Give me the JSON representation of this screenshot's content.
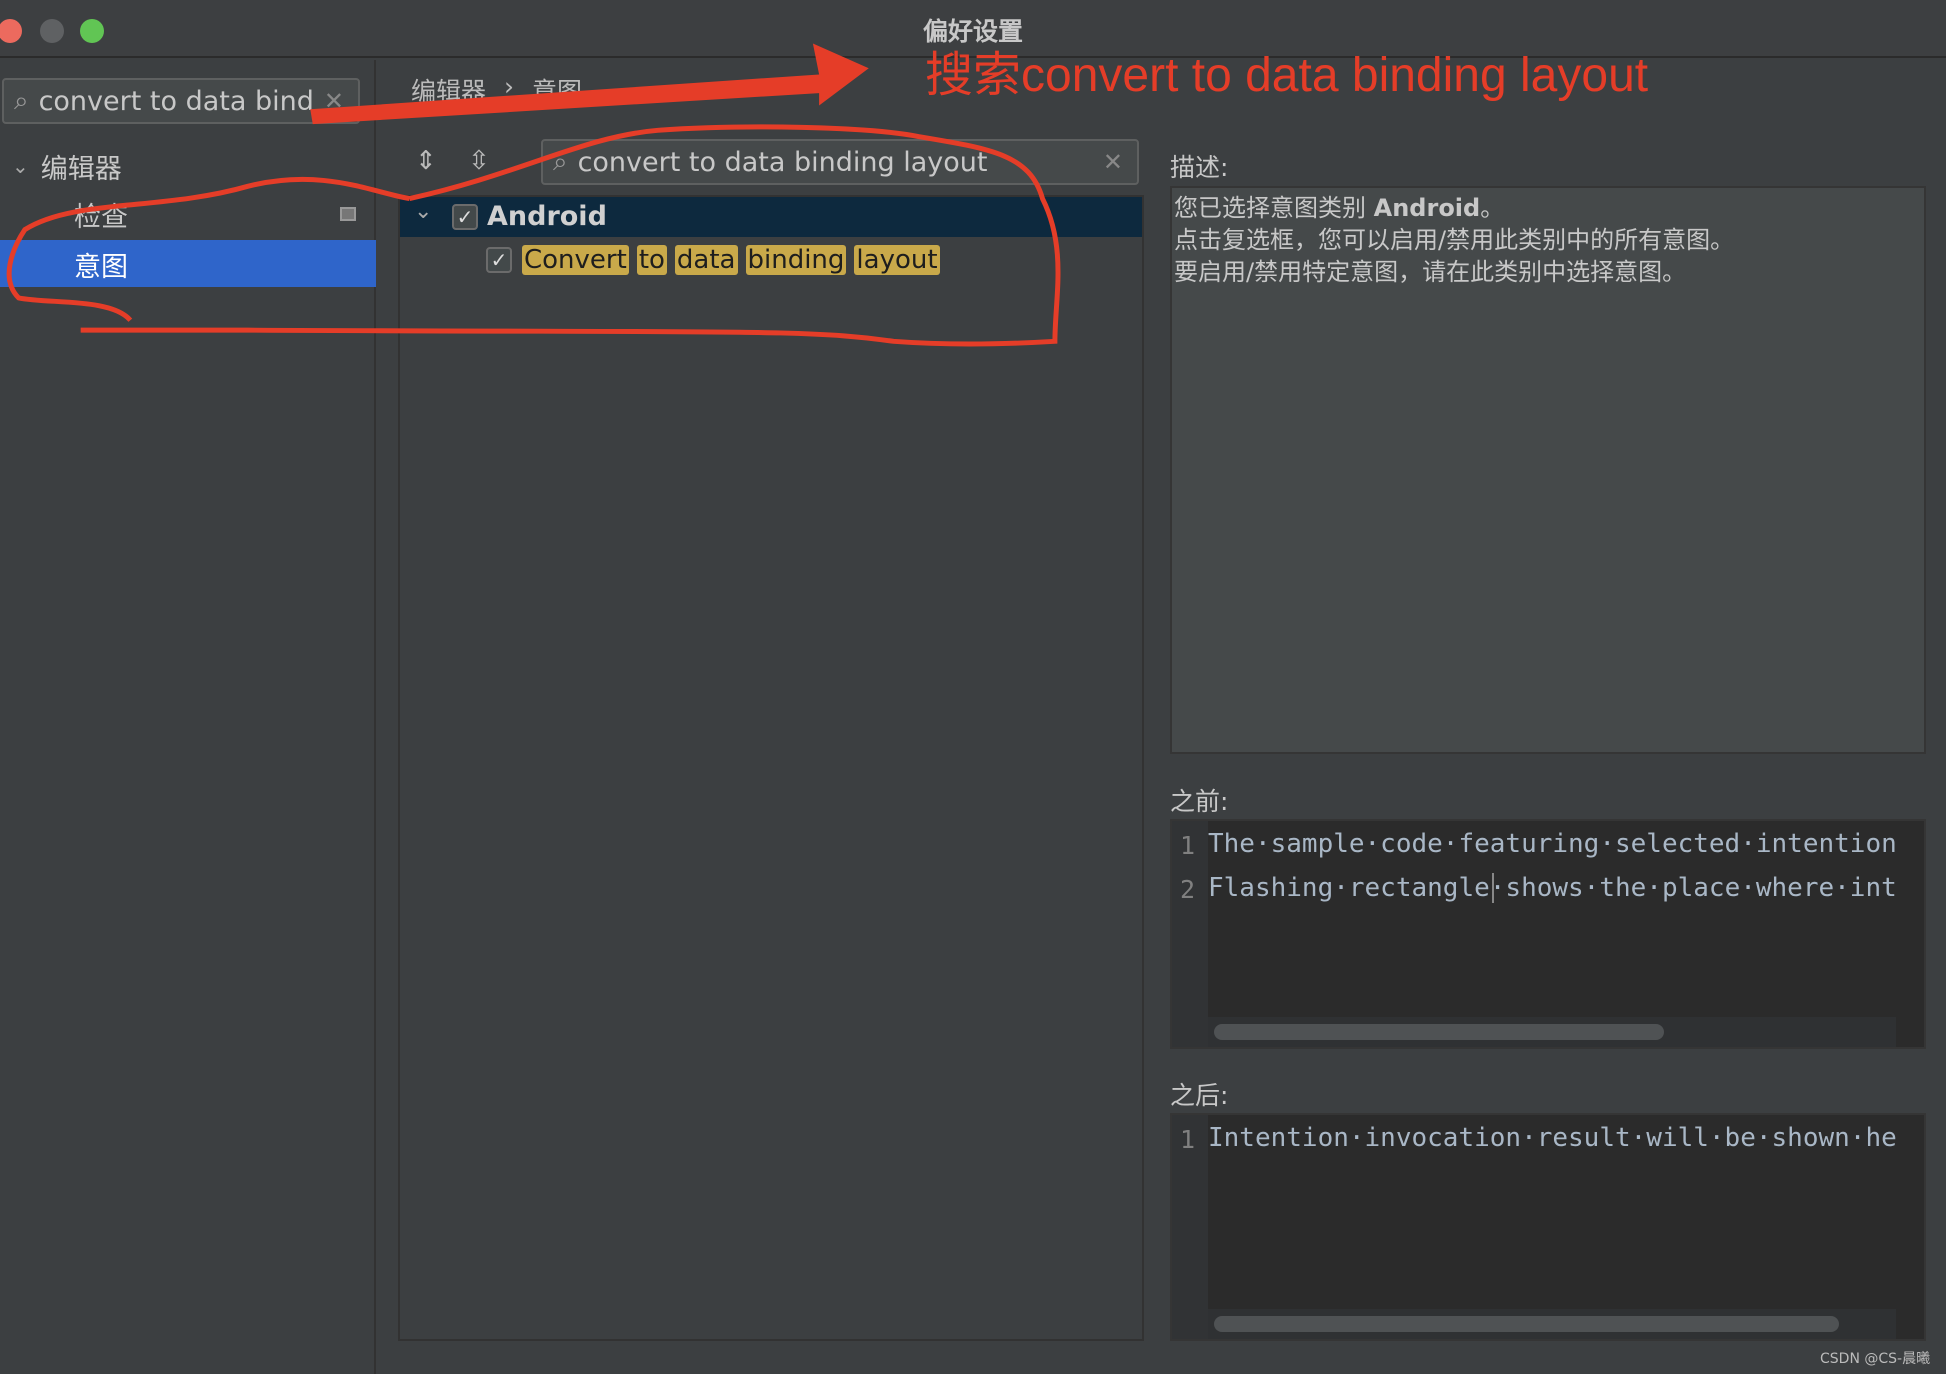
{
  "window": {
    "title": "偏好设置"
  },
  "sidebar": {
    "search_value": "convert to data bind",
    "tree": [
      {
        "label": "编辑器",
        "expanded": true
      },
      {
        "label": "检查"
      },
      {
        "label": "意图",
        "selected": true
      }
    ]
  },
  "breadcrumb": [
    "编辑器",
    "意图"
  ],
  "main": {
    "search_value": "convert to data binding layout",
    "group": {
      "label": "Android",
      "checked": true
    },
    "items": [
      {
        "words": [
          "Convert",
          "to",
          "data",
          "binding",
          "layout"
        ],
        "checked": true
      }
    ]
  },
  "description": {
    "label": "描述:",
    "line1_prefix": "您已选择意图类别 ",
    "line1_bold": "Android",
    "line1_suffix": "。",
    "line2": "点击复选框，您可以启用/禁用此类别中的所有意图。",
    "line3": "要启用/禁用特定意图，请在此类别中选择意图。"
  },
  "before": {
    "label": "之前:",
    "lines": [
      {
        "n": "1",
        "text": "The·sample·code·featuring·selected·intention"
      },
      {
        "n": "2",
        "boxed": "Flashing·rectangle",
        "text": "·shows·the·place·where·intention"
      }
    ]
  },
  "after": {
    "label": "之后:",
    "lines": [
      {
        "n": "1",
        "text": "Intention·invocation·result·will·be·shown·here"
      }
    ]
  },
  "annotation": {
    "text": "搜索convert to data binding layout",
    "color": "#e53d28"
  },
  "watermark": "CSDN @CS-晨曦",
  "colors": {
    "selection": "#2f65ca",
    "highlight": "#c9a94a",
    "group_row": "#0d293e"
  }
}
